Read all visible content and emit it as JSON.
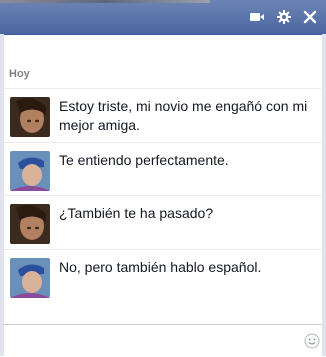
{
  "header": {
    "icons": [
      "video-call-icon",
      "gear-icon",
      "close-icon"
    ],
    "background_color": "#4b67a1"
  },
  "conversation": {
    "day_label": "Hoy",
    "messages": [
      {
        "sender": "friend",
        "avatar_icon": "friend-avatar",
        "text": "Estoy triste, mi novio me engañó con mi mejor amiga."
      },
      {
        "sender": "me",
        "avatar_icon": "user-avatar",
        "text": "Te entiendo perfectamente."
      },
      {
        "sender": "friend",
        "avatar_icon": "friend-avatar",
        "text": "¿También te ha pasado?"
      },
      {
        "sender": "me",
        "avatar_icon": "user-avatar",
        "text": "No, pero también hablo español."
      }
    ]
  },
  "composer": {
    "value": "",
    "placeholder": "",
    "emoji_icon": "smiley-icon"
  }
}
